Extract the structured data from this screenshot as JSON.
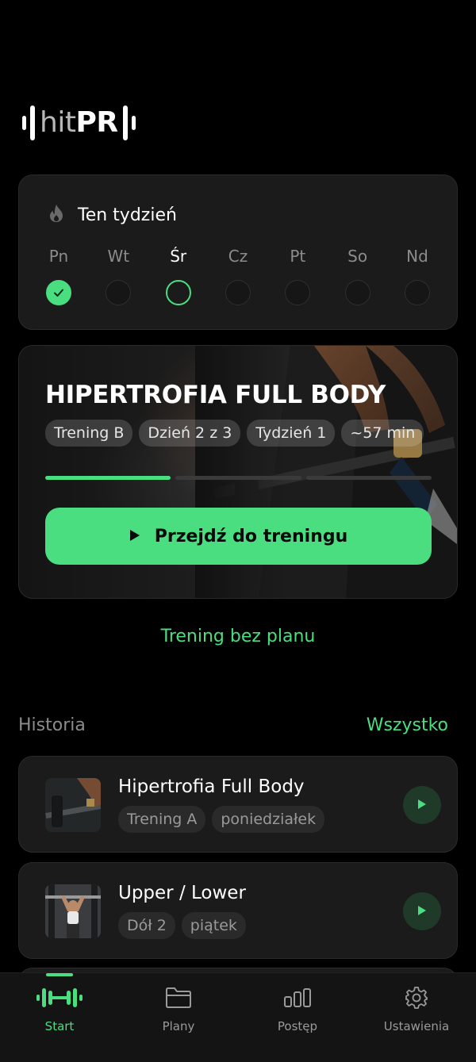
{
  "brand": {
    "hit": "hit",
    "pr": "PR"
  },
  "colors": {
    "accent": "#4ade80",
    "card": "#1b1b1b",
    "background": "#000000"
  },
  "week": {
    "title": "Ten tydzień",
    "icon": "flame-icon",
    "days": [
      {
        "label": "Pn",
        "status": "done"
      },
      {
        "label": "Wt",
        "status": "empty"
      },
      {
        "label": "Śr",
        "status": "today"
      },
      {
        "label": "Cz",
        "status": "empty"
      },
      {
        "label": "Pt",
        "status": "empty"
      },
      {
        "label": "So",
        "status": "empty"
      },
      {
        "label": "Nd",
        "status": "empty"
      }
    ]
  },
  "current_plan": {
    "title": "HIPERTROFIA FULL BODY",
    "chips": [
      "Trening B",
      "Dzień 2 z 3",
      "Tydzień 1",
      "~57 min"
    ],
    "progress_segments": [
      1,
      0,
      0
    ],
    "button_label": "Przejdź do treningu"
  },
  "free_training_label": "Trening bez planu",
  "history": {
    "title": "Historia",
    "all_label": "Wszystko",
    "items": [
      {
        "name": "Hipertrofia Full Body",
        "chips": [
          "Trening A",
          "poniedziałek"
        ]
      },
      {
        "name": "Upper / Lower",
        "chips": [
          "Dół 2",
          "piątek"
        ]
      }
    ]
  },
  "nav": [
    {
      "label": "Start",
      "icon": "dumbbell-icon",
      "active": true
    },
    {
      "label": "Plany",
      "icon": "folder-icon",
      "active": false
    },
    {
      "label": "Postęp",
      "icon": "bar-chart-icon",
      "active": false
    },
    {
      "label": "Ustawienia",
      "icon": "gear-icon",
      "active": false
    }
  ]
}
